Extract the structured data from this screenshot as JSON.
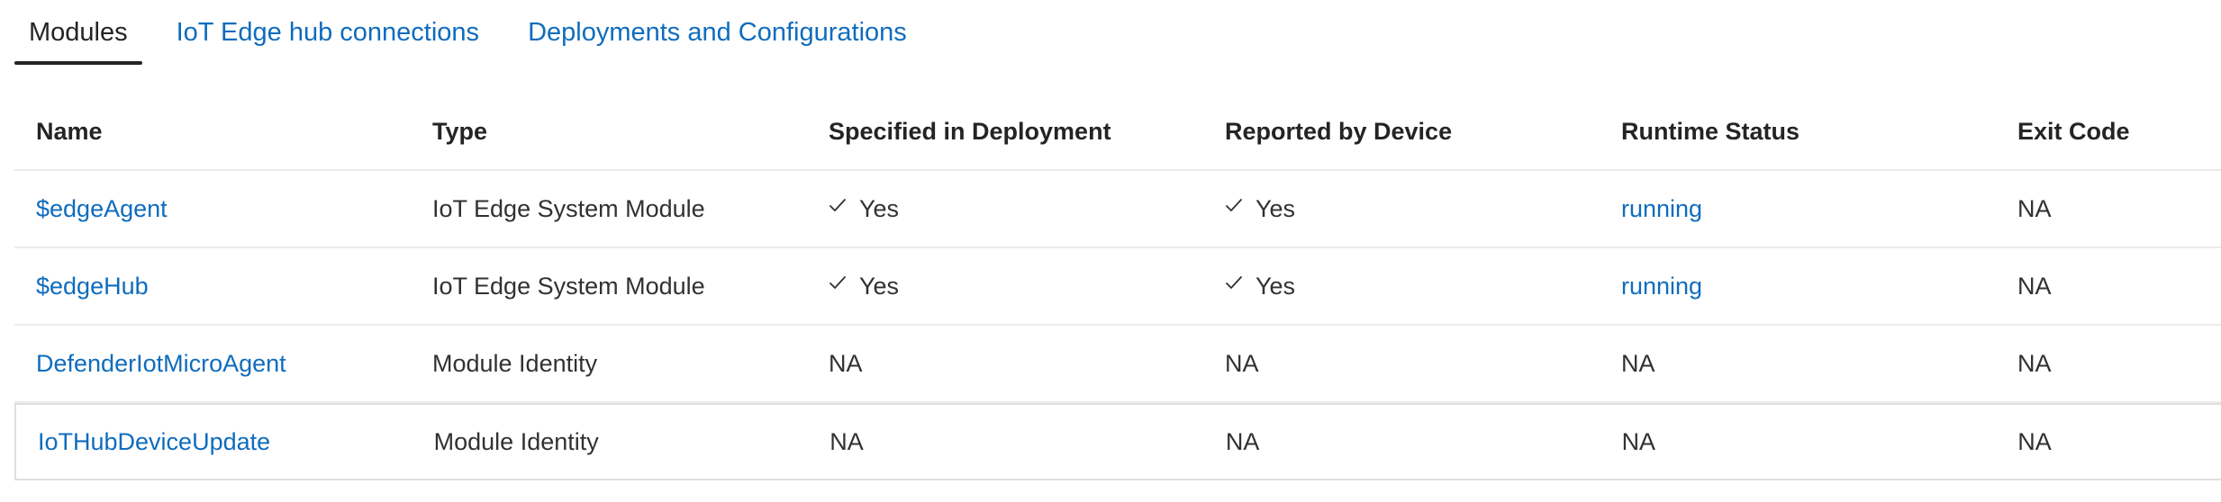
{
  "tabs": [
    {
      "label": "Modules",
      "active": true
    },
    {
      "label": "IoT Edge hub connections",
      "active": false
    },
    {
      "label": "Deployments and Configurations",
      "active": false
    }
  ],
  "table": {
    "columns": [
      "Name",
      "Type",
      "Specified in Deployment",
      "Reported by Device",
      "Runtime Status",
      "Exit Code"
    ],
    "rows": [
      {
        "name": "$edgeAgent",
        "type": "IoT Edge System Module",
        "specified": "Yes",
        "reported": "Yes",
        "runtime": "running",
        "exit": "NA"
      },
      {
        "name": "$edgeHub",
        "type": "IoT Edge System Module",
        "specified": "Yes",
        "reported": "Yes",
        "runtime": "running",
        "exit": "NA"
      },
      {
        "name": "DefenderIotMicroAgent",
        "type": "Module Identity",
        "specified": "NA",
        "reported": "NA",
        "runtime": "NA",
        "exit": "NA"
      },
      {
        "name": "IoTHubDeviceUpdate",
        "type": "Module Identity",
        "specified": "NA",
        "reported": "NA",
        "runtime": "NA",
        "exit": "NA"
      }
    ]
  },
  "icons": {
    "check": "checkmark-icon"
  },
  "colors": {
    "link": "#0f6cbd",
    "text": "#323130",
    "divider": "#edebe9"
  }
}
